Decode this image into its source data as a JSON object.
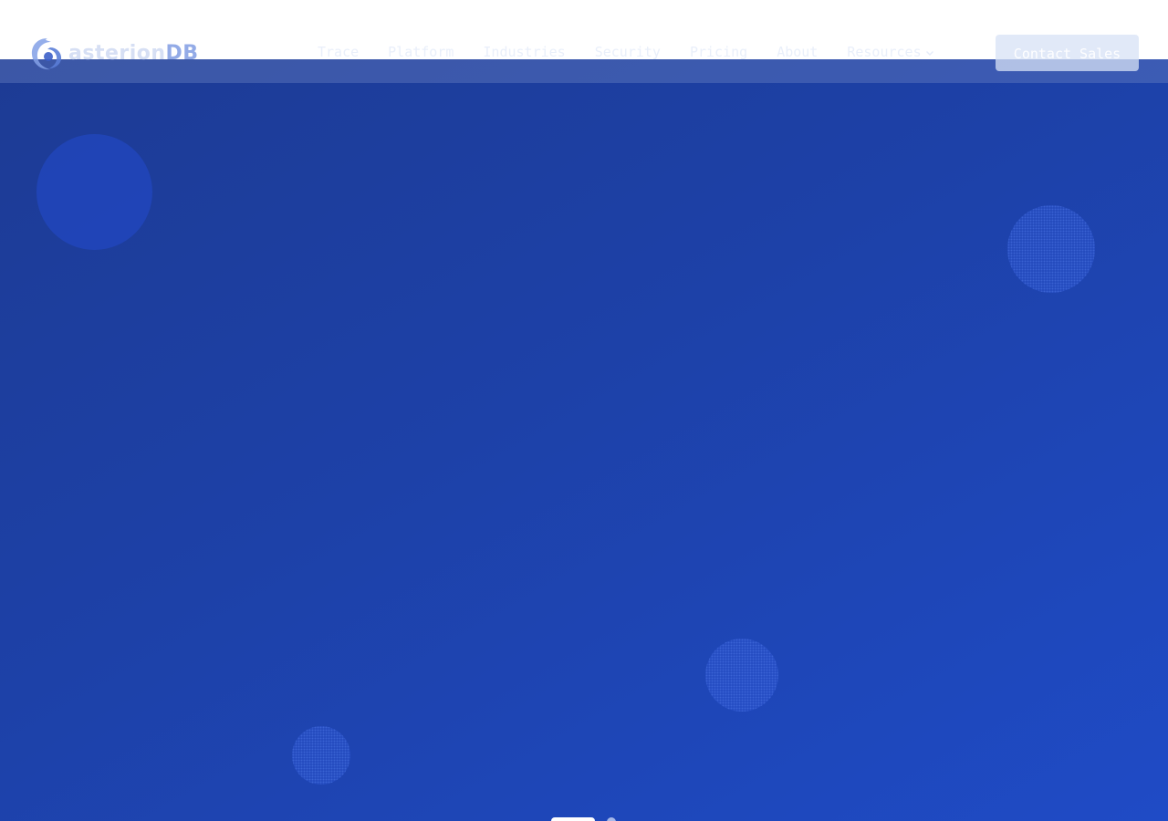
{
  "brand": {
    "logo_text": "asterion",
    "logo_suffix": "DB",
    "accent_color": "#1f4bc6",
    "icon": "asteriondb-swirl-icon"
  },
  "nav": {
    "items": [
      {
        "label": "Trace"
      },
      {
        "label": "Platform"
      },
      {
        "label": "Industries"
      },
      {
        "label": "Security"
      },
      {
        "label": "Pricing"
      },
      {
        "label": "About"
      },
      {
        "label": "Resources",
        "icon": "chevron-down-icon"
      }
    ],
    "cta_label": "Contact Sales"
  },
  "slider": {
    "slide_count": 2,
    "active_index": 0
  }
}
